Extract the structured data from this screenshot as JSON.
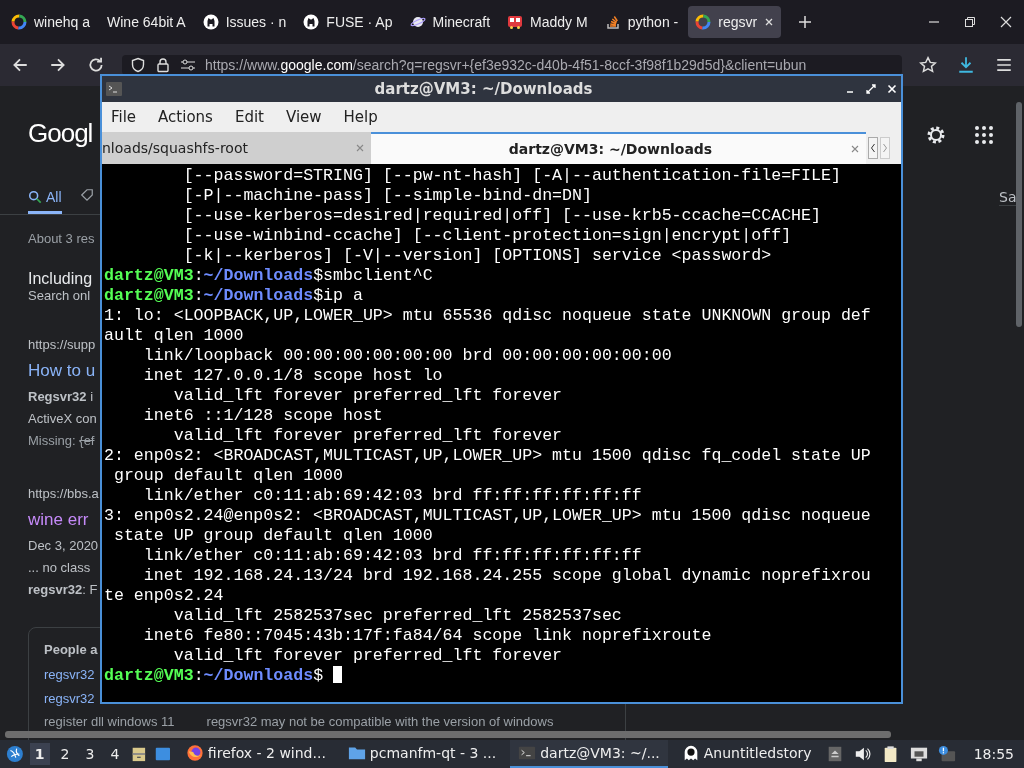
{
  "browser": {
    "tabs": [
      {
        "kind": "google",
        "label": "winehq a",
        "selected": false
      },
      {
        "kind": "none",
        "label": "Wine 64bit A",
        "selected": false
      },
      {
        "kind": "github",
        "label": "Issues · n",
        "selected": false
      },
      {
        "kind": "github",
        "label": "FUSE · Ap",
        "selected": false
      },
      {
        "kind": "planet",
        "label": "Minecraft",
        "selected": false
      },
      {
        "kind": "bus",
        "label": "Maddy M",
        "selected": false
      },
      {
        "kind": "stack",
        "label": "python - ",
        "selected": false
      },
      {
        "kind": "google",
        "label": "regsvr",
        "selected": true
      }
    ],
    "url": {
      "host_before": "https://www.",
      "host": "google.com",
      "rest": "/search?q=regsvr+{ef3e932c-d40b-4f51-8ccf-3f98f1b29d5d}&client=ubun"
    }
  },
  "google": {
    "logo": "Googl",
    "nav": [
      {
        "label": "All",
        "selected": true
      }
    ],
    "right_nav": "Sa",
    "stats": "About 3 res",
    "including": "Including",
    "search_only": "Search onl",
    "results": [
      {
        "url": "https://supp",
        "title": "How to u",
        "visited": false,
        "snippet": [
          "**Regsvr32** i",
          "ActiveX con"
        ],
        "missing": {
          "label": "Missing:",
          "struck": "{ef"
        }
      },
      {
        "url": "https://bbs.a",
        "title": "wine err",
        "visited": true,
        "date": "Dec 3, 2020",
        "snippet": [
          "... no class",
          "**regsvr32**: F"
        ]
      }
    ],
    "people_also_ask": {
      "title": "People a",
      "links": [
        "regsvr32",
        "regsvr32"
      ],
      "bottom": [
        "register dll windows 11",
        "regsvr32 may not be compatible with the version of windows"
      ]
    }
  },
  "terminal": {
    "title": "dartz@VM3: ~/Downloads",
    "menu": [
      "File",
      "Actions",
      "Edit",
      "View",
      "Help"
    ],
    "tabs": [
      {
        "label": "nloads/squashfs-root",
        "selected": false
      },
      {
        "label": "dartz@VM3: ~/Downloads",
        "selected": true
      }
    ],
    "lines": [
      {
        "kind": "output",
        "text": "        [--password=STRING] [--pw-nt-hash] [-A|--authentication-file=FILE]"
      },
      {
        "kind": "output",
        "text": "        [-P|--machine-pass] [--simple-bind-dn=DN]"
      },
      {
        "kind": "output",
        "text": "        [--use-kerberos=desired|required|off] [--use-krb5-ccache=CCACHE]"
      },
      {
        "kind": "output",
        "text": "        [--use-winbind-ccache] [--client-protection=sign|encrypt|off]"
      },
      {
        "kind": "output",
        "text": "        [-k|--kerberos] [-V|--version] [OPTIONS] service <password>"
      },
      {
        "kind": "prompt",
        "user": "dartz@VM3",
        "colon": ":",
        "path": "~/Downloads",
        "dollar": "$",
        "command": "smbclient^C"
      },
      {
        "kind": "prompt",
        "user": "dartz@VM3",
        "colon": ":",
        "path": "~/Downloads",
        "dollar": "$",
        "command": "ip a"
      },
      {
        "kind": "output",
        "text": "1: lo: <LOOPBACK,UP,LOWER_UP> mtu 65536 qdisc noqueue state UNKNOWN group def"
      },
      {
        "kind": "output",
        "text": "ault qlen 1000"
      },
      {
        "kind": "output",
        "text": "    link/loopback 00:00:00:00:00:00 brd 00:00:00:00:00:00"
      },
      {
        "kind": "output",
        "text": "    inet 127.0.0.1/8 scope host lo"
      },
      {
        "kind": "output",
        "text": "       valid_lft forever preferred_lft forever"
      },
      {
        "kind": "output",
        "text": "    inet6 ::1/128 scope host"
      },
      {
        "kind": "output",
        "text": "       valid_lft forever preferred_lft forever"
      },
      {
        "kind": "output",
        "text": "2: enp0s2: <BROADCAST,MULTICAST,UP,LOWER_UP> mtu 1500 qdisc fq_codel state UP"
      },
      {
        "kind": "output",
        "text": " group default qlen 1000"
      },
      {
        "kind": "output",
        "text": "    link/ether c0:11:ab:69:42:03 brd ff:ff:ff:ff:ff:ff"
      },
      {
        "kind": "output",
        "text": "3: enp0s2.24@enp0s2: <BROADCAST,MULTICAST,UP,LOWER_UP> mtu 1500 qdisc noqueue"
      },
      {
        "kind": "output",
        "text": " state UP group default qlen 1000"
      },
      {
        "kind": "output",
        "text": "    link/ether c0:11:ab:69:42:03 brd ff:ff:ff:ff:ff:ff"
      },
      {
        "kind": "output",
        "text": "    inet 192.168.24.13/24 brd 192.168.24.255 scope global dynamic noprefixrou"
      },
      {
        "kind": "output",
        "text": "te enp0s2.24"
      },
      {
        "kind": "output",
        "text": "       valid_lft 2582537sec preferred_lft 2582537sec"
      },
      {
        "kind": "output",
        "text": "    inet6 fe80::7045:43b:17f:fa84/64 scope link noprefixroute"
      },
      {
        "kind": "output",
        "text": "       valid_lft forever preferred_lft forever"
      },
      {
        "kind": "prompt",
        "user": "dartz@VM3",
        "colon": ":",
        "path": "~/Downloads",
        "dollar": "$",
        "cursor": true
      }
    ]
  },
  "taskbar": {
    "workspaces": [
      {
        "label": "1",
        "selected": true
      },
      {
        "label": "2",
        "selected": false
      },
      {
        "label": "3",
        "selected": false
      },
      {
        "label": "4",
        "selected": false
      }
    ],
    "tasks": [
      {
        "kind": "firefox",
        "label": "firefox - 2 wind...",
        "selected": false
      },
      {
        "kind": "folder",
        "label": "pcmanfm-qt - 3 ...",
        "selected": false
      },
      {
        "kind": "terminal",
        "label": "dartz@VM3: ~/...",
        "selected": true
      },
      {
        "kind": "ghost",
        "label": "Anuntitledstory",
        "selected": false
      }
    ],
    "clock": "18:55"
  }
}
